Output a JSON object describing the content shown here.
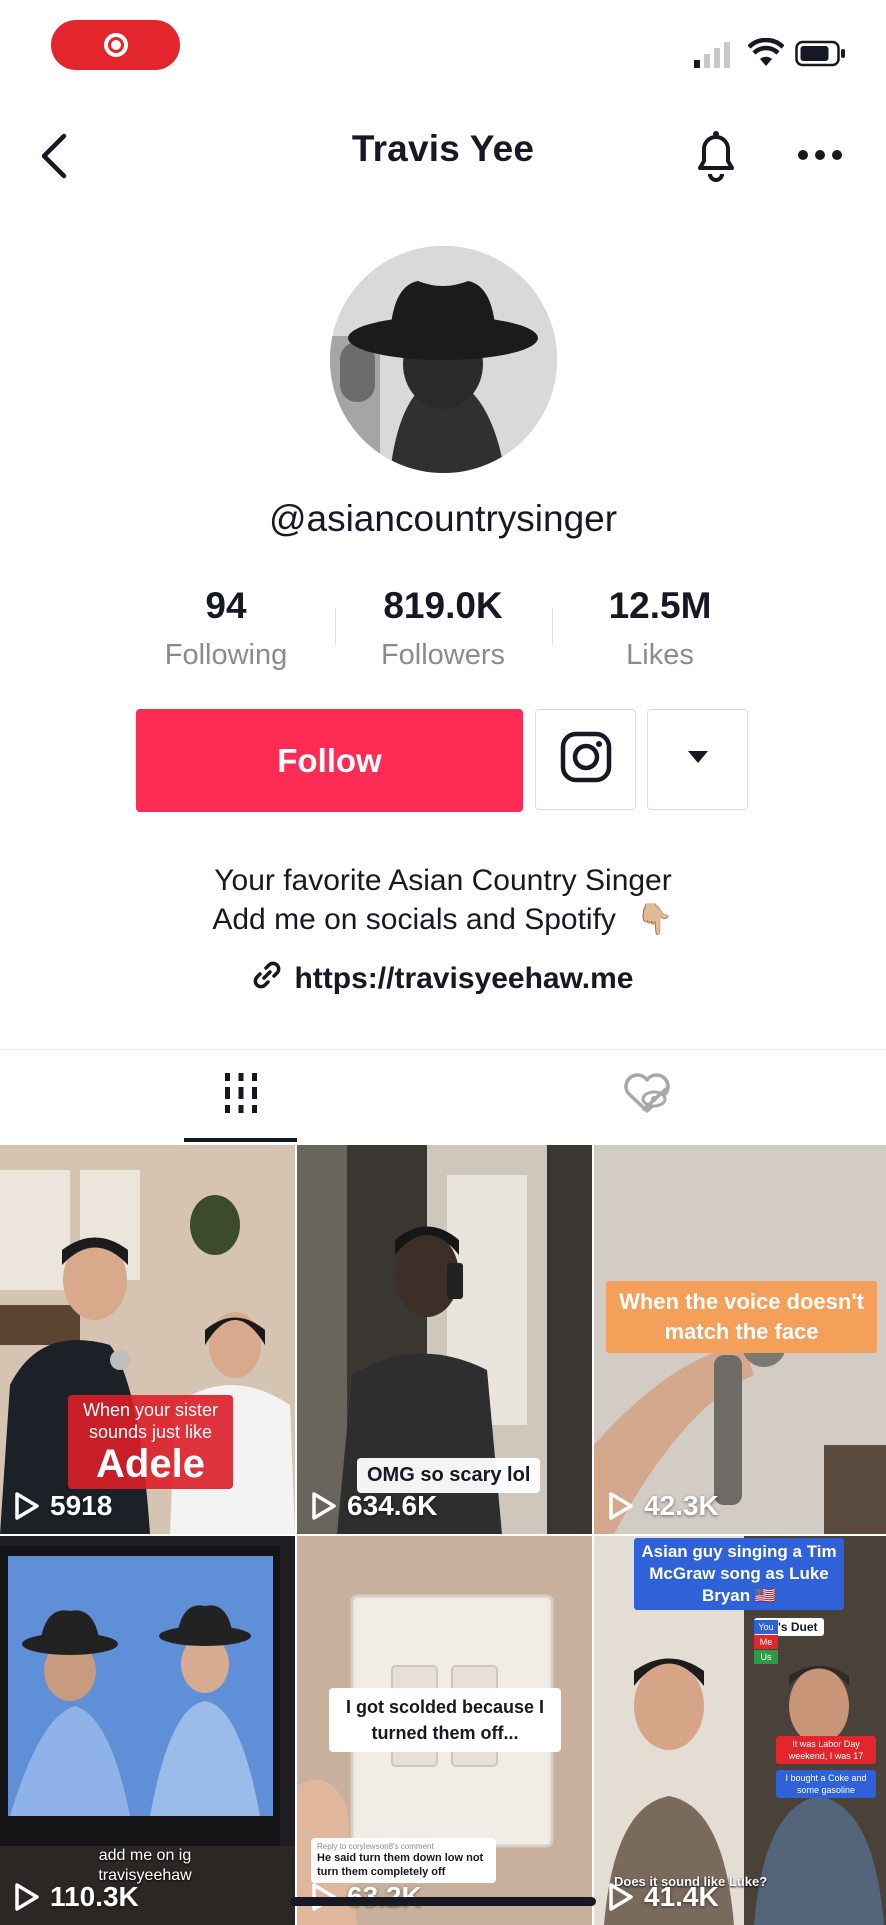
{
  "header": {
    "title": "Travis Yee"
  },
  "profile": {
    "handle": "@asiancountrysinger",
    "stats": [
      {
        "value": "94",
        "label": "Following"
      },
      {
        "value": "819.0K",
        "label": "Followers"
      },
      {
        "value": "12.5M",
        "label": "Likes"
      }
    ],
    "follow_label": "Follow",
    "bio_line1": "Your favorite Asian Country Singer",
    "bio_line2": "Add me on socials and Spotify",
    "bio_emoji": "👇🏼",
    "link": "https://travisyeehaw.me"
  },
  "icons": {
    "back": "back-arrow-icon",
    "bell": "bell-icon",
    "more": "more-dots-icon",
    "instagram": "instagram-icon",
    "dropdown": "caret-down-icon",
    "link": "link-icon",
    "videos_tab": "grid-icon",
    "liked_tab": "hidden-heart-icon",
    "play": "play-icon"
  },
  "colors": {
    "accent": "#fe2c55",
    "record": "#e2262b",
    "muted": "#8a8b91"
  },
  "videos": [
    {
      "views": "5918",
      "caption_small": "When your sister sounds just like",
      "caption_big": "Adele"
    },
    {
      "views": "634.6K",
      "caption": "OMG so scary lol"
    },
    {
      "views": "42.3K",
      "caption": "When the voice doesn't match the face"
    },
    {
      "views": "110.3K",
      "caption": "add me on ig travisyeehaw"
    },
    {
      "views": "63.2K",
      "caption": "I got scolded because I turned them off...",
      "reply_header": "Reply to corylewson8's comment",
      "reply_text": "He said turn them down low not turn them completely off"
    },
    {
      "views": "41.4K",
      "caption": "Asian guy singing a Tim McGraw song as Luke Bryan 🇺🇸",
      "tag": "Let's Duet",
      "bottom": "Does it sound like Luke?",
      "bubble1": "It was Labor Day weekend, I was 17",
      "bubble2": "I bought a Coke and some gasoline",
      "poll": [
        "You",
        "Me",
        "Us"
      ]
    }
  ]
}
